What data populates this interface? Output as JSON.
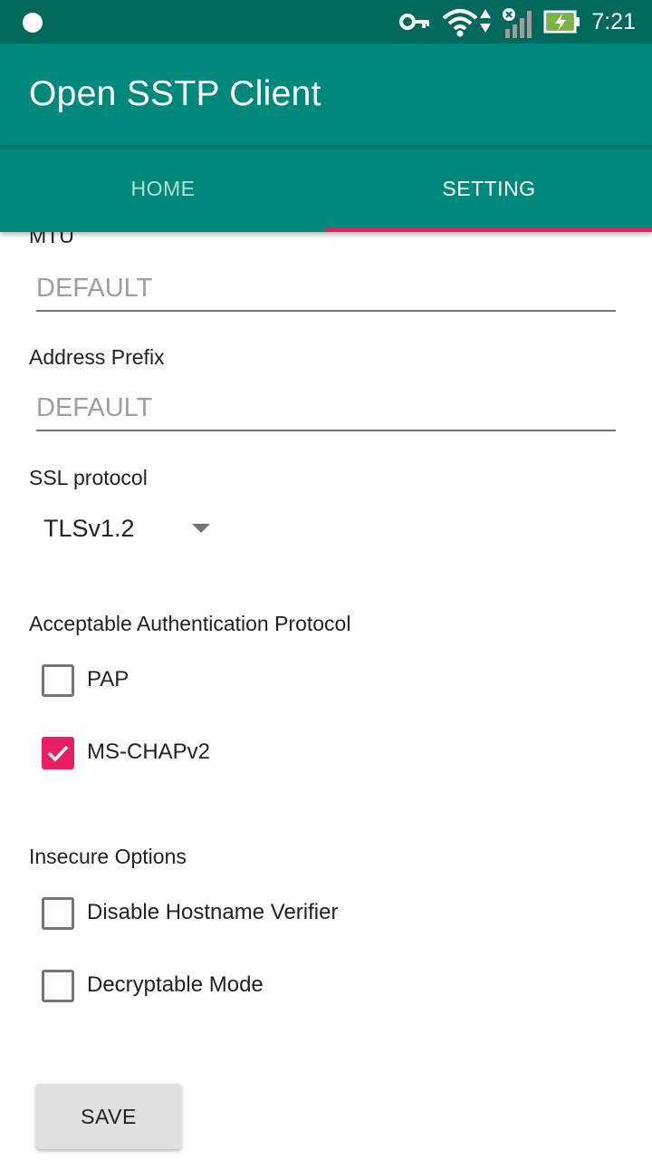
{
  "status_bar": {
    "time": "7:21",
    "icons": [
      "key-icon",
      "wifi-icon",
      "signal-icon",
      "battery-charging-icon"
    ]
  },
  "app_bar": {
    "title": "Open SSTP Client"
  },
  "tabs": [
    {
      "label": "HOME",
      "selected": false
    },
    {
      "label": "SETTING",
      "selected": true
    }
  ],
  "settings": {
    "mtu": {
      "label": "MTU",
      "placeholder": "DEFAULT",
      "value": ""
    },
    "address_prefix": {
      "label": "Address Prefix",
      "placeholder": "DEFAULT",
      "value": ""
    },
    "ssl_protocol": {
      "label": "SSL protocol",
      "selected": "TLSv1.2"
    },
    "auth_protocol": {
      "label": "Acceptable Authentication Protocol",
      "options": [
        {
          "label": "PAP",
          "checked": false
        },
        {
          "label": "MS-CHAPv2",
          "checked": true
        }
      ]
    },
    "insecure_options": {
      "label": "Insecure Options",
      "options": [
        {
          "label": "Disable Hostname Verifier",
          "checked": false
        },
        {
          "label": "Decryptable Mode",
          "checked": false
        }
      ]
    }
  },
  "save_button": {
    "label": "SAVE"
  },
  "colors": {
    "status_bar": "#00695c",
    "primary": "#00897b",
    "accent": "#e91e63"
  }
}
